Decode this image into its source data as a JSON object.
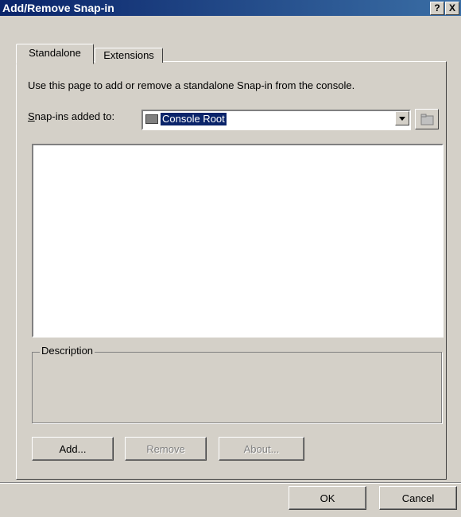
{
  "window": {
    "title": "Add/Remove Snap-in",
    "help_label": "?",
    "close_label": "X"
  },
  "tabs": [
    {
      "label": "Standalone",
      "active": true
    },
    {
      "label": "Extensions",
      "active": false
    }
  ],
  "standalone": {
    "instruction": "Use this page to add or remove a standalone Snap-in from the console.",
    "snapins_label": "Snap-ins added to:",
    "snapins_selected": "Console Root",
    "list_items": [],
    "description_title": "Description",
    "description_text": ""
  },
  "buttons": {
    "add": "Add...",
    "remove": "Remove",
    "about": "About...",
    "ok": "OK",
    "cancel": "Cancel"
  },
  "icons": {
    "folder": "folder-icon",
    "dropdown": "chevron-down-icon",
    "up_folder": "up-folder-icon"
  }
}
